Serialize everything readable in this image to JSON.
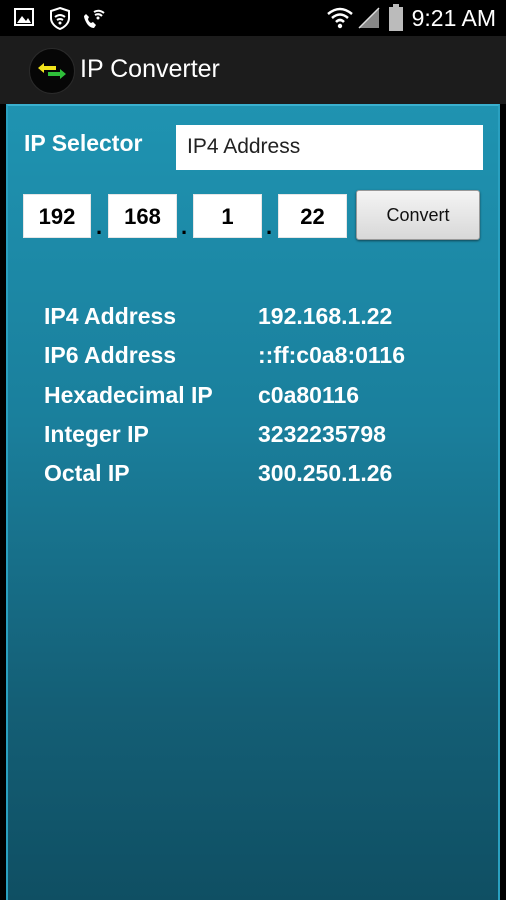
{
  "status_bar": {
    "time": "9:21 AM",
    "icons": [
      "image-icon",
      "shield-wifi-icon",
      "wifi-call-icon",
      "wifi-icon",
      "signal-icon",
      "battery-icon"
    ]
  },
  "action_bar": {
    "title": "IP Converter",
    "logo_icon": "arrows-exchange-icon"
  },
  "form": {
    "selector_label": "IP Selector",
    "selector_value": "IP4 Address",
    "octets": [
      "192",
      "168",
      "1",
      "22"
    ],
    "dot": ".",
    "convert_label": "Convert"
  },
  "results": [
    {
      "label": "IP4 Address",
      "value": "192.168.1.22"
    },
    {
      "label": "IP6 Address",
      "value": "::ff:c0a8:0116"
    },
    {
      "label": "Hexadecimal IP",
      "value": "c0a80116"
    },
    {
      "label": "Integer IP",
      "value": "3232235798"
    },
    {
      "label": "Octal IP",
      "value": "300.250.1.26"
    }
  ],
  "colors": {
    "content_top": "#1f93b1",
    "content_bottom": "#0f4f63",
    "action_bar": "#1c1c1c",
    "status_bar": "#000000"
  }
}
